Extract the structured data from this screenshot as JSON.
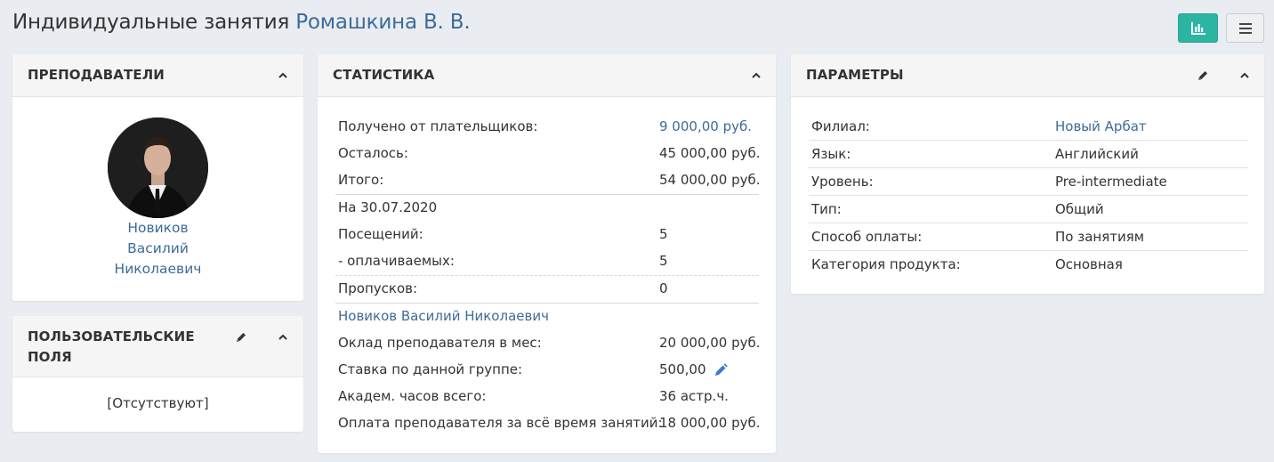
{
  "header": {
    "title": "Индивидуальные занятия",
    "student_name": "Ромашкина В. В."
  },
  "toolbar": {
    "stats_button_icon": "bar-chart-icon",
    "menu_button_icon": "hamburger-menu-icon",
    "stats_button_color": "#2bb5a2"
  },
  "teachers_panel": {
    "title": "ПРЕПОДАВАТЕЛИ",
    "teacher": {
      "last_name": "Новиков",
      "first_name": "Василий",
      "patronymic": "Николаевич"
    }
  },
  "custom_fields_panel": {
    "title_line1": "ПОЛЬЗОВАТЕЛЬСКИЕ",
    "title_line2": "ПОЛЯ",
    "empty_text": "[Отсутствуют]"
  },
  "stats_panel": {
    "title": "СТАТИСТИКА",
    "received_label": "Получено от плательщиков:",
    "received_value": "9 000,00 руб.",
    "remaining_label": "Осталось:",
    "remaining_value": "45 000,00 руб.",
    "total_label": "Итого:",
    "total_value": "54 000,00 руб.",
    "as_of_label": "На 30.07.2020",
    "visits_label": "Посещений:",
    "visits_value": "5",
    "paid_label": "- оплачиваемых:",
    "paid_value": "5",
    "absences_label": "Пропусков:",
    "absences_value": "0",
    "teacher_link": "Новиков Василий Николаевич",
    "salary_label": "Оклад преподавателя в мес:",
    "salary_value": "20 000,00 руб.",
    "rate_label": "Ставка по данной группе:",
    "rate_value": "500,00",
    "hours_label": "Академ. часов всего:",
    "hours_value": "36 астр.ч.",
    "teacher_pay_label": "Оплата преподавателя за всё время занятий:",
    "teacher_pay_value": "18 000,00 руб."
  },
  "params_panel": {
    "title": "ПАРАМЕТРЫ",
    "rows": [
      {
        "label": "Филиал:",
        "value": "Новый Арбат"
      },
      {
        "label": "Язык:",
        "value": "Английский"
      },
      {
        "label": "Уровень:",
        "value": "Pre-intermediate"
      },
      {
        "label": "Тип:",
        "value": "Общий"
      },
      {
        "label": "Способ оплаты:",
        "value": "По занятиям"
      },
      {
        "label": "Категория продукта:",
        "value": "Основная"
      }
    ]
  },
  "colors": {
    "link": "#3d6c99",
    "background": "#e9ecf1",
    "accent": "#2bb5a2"
  }
}
